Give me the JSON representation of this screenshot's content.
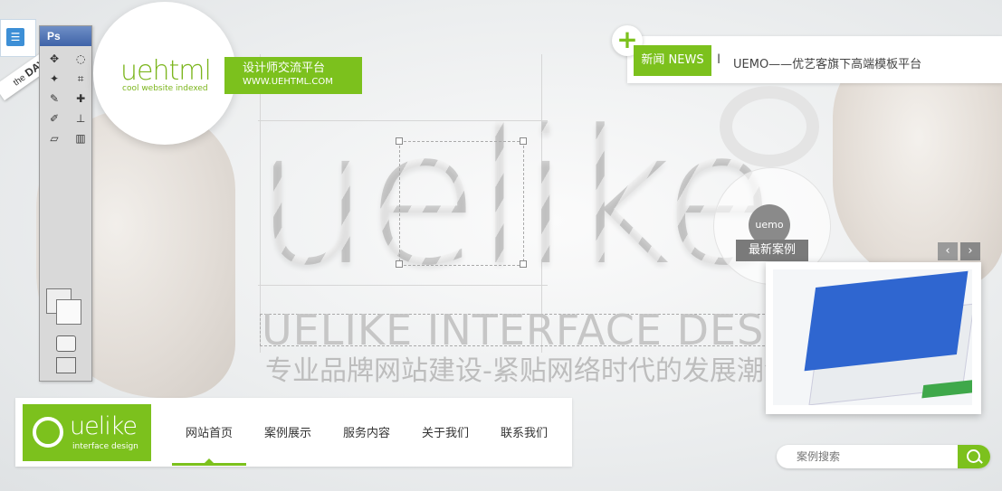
{
  "menu": {
    "icon": "list-icon"
  },
  "ribbon": {
    "small": "the",
    "day": "DAY"
  },
  "photoshop": {
    "title": "Ps"
  },
  "uehtml": {
    "logo": "uehtml",
    "tagline": "cool website indexed",
    "slogan_cn": "设计师交流平台",
    "slogan_url": "WWW.UEHTML.COM"
  },
  "hero": {
    "word": "uelike",
    "headline_en": "UELIKE INTERFACE DESIGN",
    "headline_cn": "专业品牌网站建设-紧贴网络时代的发展潮流"
  },
  "news": {
    "label": "新闻 NEWS",
    "item": "UEMO——优艺客旗下高端模板平台"
  },
  "cases": {
    "badge": "uemo",
    "label": "最新案例",
    "prev": "‹",
    "next": "›"
  },
  "brand": {
    "name": "uelike",
    "sub": "interface design"
  },
  "nav": {
    "items": [
      {
        "label": "网站首页",
        "active": true
      },
      {
        "label": "案例展示"
      },
      {
        "label": "服务内容"
      },
      {
        "label": "关于我们"
      },
      {
        "label": "联系我们"
      }
    ]
  },
  "search": {
    "placeholder": "案例搜索"
  },
  "colors": {
    "accent": "#7cc11d",
    "ps_blue": "#3f63a8"
  }
}
